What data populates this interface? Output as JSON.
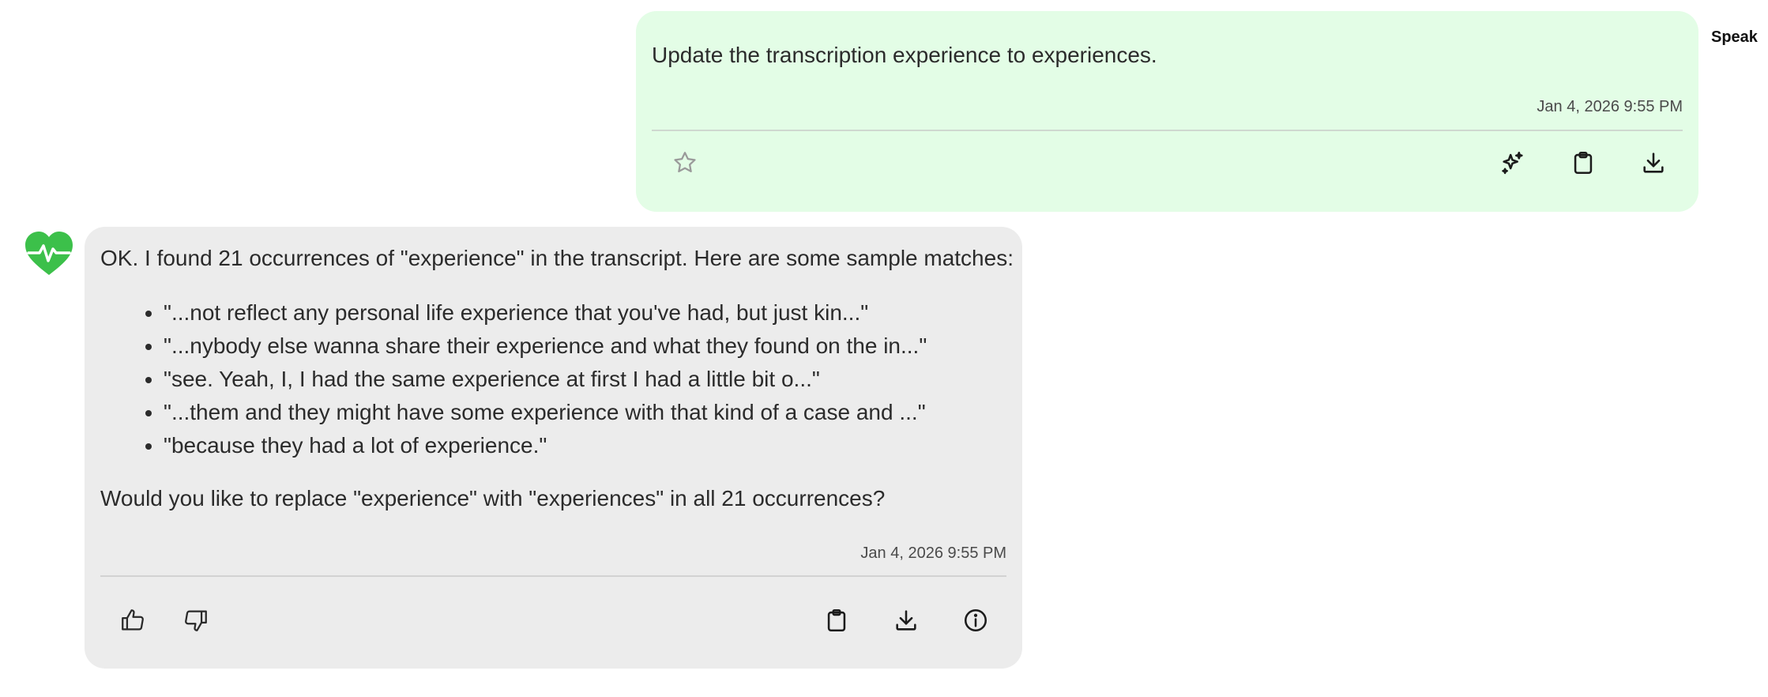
{
  "user_message": {
    "text": "Update the transcription experience to experiences.",
    "timestamp": "Jan 4, 2026 9:55 PM",
    "speaker_label": "Speak"
  },
  "assistant_message": {
    "intro": "OK. I found 21 occurrences of \"experience\" in the transcript. Here are some sample matches:",
    "matches": [
      "\"...not reflect any personal life experience that you've had, but just kin...\"",
      "\"...nybody else wanna share their experience and what they found on the in...\"",
      "\"see. Yeah, I, I had the same experience at first I had a little bit o...\"",
      "\"...them and they might have some experience with that kind of a case and ...\"",
      "\"because they had a lot of experience.\""
    ],
    "question": "Would you like to replace \"experience\" with \"experiences\" in all 21 occurrences?",
    "timestamp": "Jan 4, 2026 9:55 PM"
  },
  "icons": {
    "user_actions": [
      "star-icon",
      "sparkles-icon",
      "clipboard-icon",
      "download-icon"
    ],
    "bot_actions": [
      "thumbs-up-icon",
      "thumbs-down-icon",
      "clipboard-icon",
      "download-icon",
      "info-icon"
    ],
    "avatar": "heart-pulse-icon"
  },
  "colors": {
    "user_bubble": "#e3fde6",
    "bot_bubble": "#ececec",
    "avatar_green": "#3cc04a"
  }
}
